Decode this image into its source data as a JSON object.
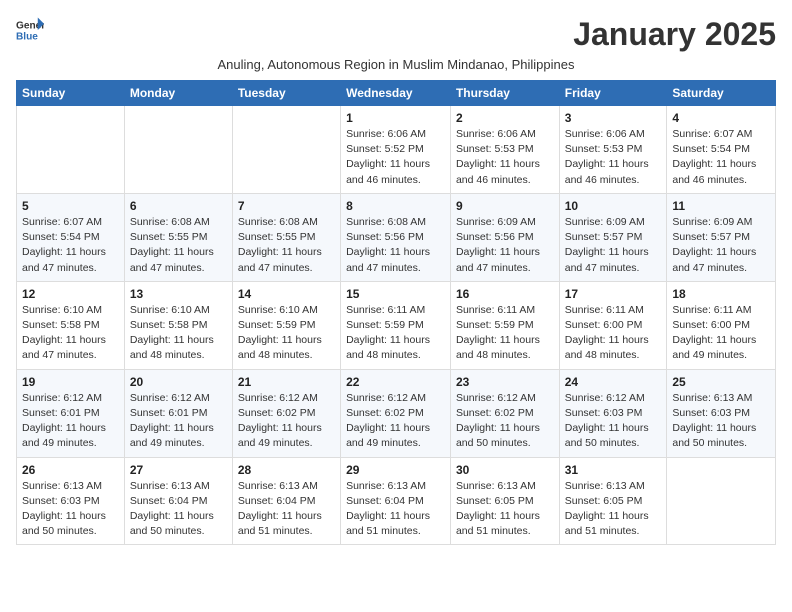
{
  "logo": {
    "general": "General",
    "blue": "Blue"
  },
  "title": "January 2025",
  "subtitle": "Anuling, Autonomous Region in Muslim Mindanao, Philippines",
  "days_of_week": [
    "Sunday",
    "Monday",
    "Tuesday",
    "Wednesday",
    "Thursday",
    "Friday",
    "Saturday"
  ],
  "weeks": [
    [
      {
        "day": "",
        "sunrise": "",
        "sunset": "",
        "daylight": ""
      },
      {
        "day": "",
        "sunrise": "",
        "sunset": "",
        "daylight": ""
      },
      {
        "day": "",
        "sunrise": "",
        "sunset": "",
        "daylight": ""
      },
      {
        "day": "1",
        "sunrise": "Sunrise: 6:06 AM",
        "sunset": "Sunset: 5:52 PM",
        "daylight": "Daylight: 11 hours and 46 minutes."
      },
      {
        "day": "2",
        "sunrise": "Sunrise: 6:06 AM",
        "sunset": "Sunset: 5:53 PM",
        "daylight": "Daylight: 11 hours and 46 minutes."
      },
      {
        "day": "3",
        "sunrise": "Sunrise: 6:06 AM",
        "sunset": "Sunset: 5:53 PM",
        "daylight": "Daylight: 11 hours and 46 minutes."
      },
      {
        "day": "4",
        "sunrise": "Sunrise: 6:07 AM",
        "sunset": "Sunset: 5:54 PM",
        "daylight": "Daylight: 11 hours and 46 minutes."
      }
    ],
    [
      {
        "day": "5",
        "sunrise": "Sunrise: 6:07 AM",
        "sunset": "Sunset: 5:54 PM",
        "daylight": "Daylight: 11 hours and 47 minutes."
      },
      {
        "day": "6",
        "sunrise": "Sunrise: 6:08 AM",
        "sunset": "Sunset: 5:55 PM",
        "daylight": "Daylight: 11 hours and 47 minutes."
      },
      {
        "day": "7",
        "sunrise": "Sunrise: 6:08 AM",
        "sunset": "Sunset: 5:55 PM",
        "daylight": "Daylight: 11 hours and 47 minutes."
      },
      {
        "day": "8",
        "sunrise": "Sunrise: 6:08 AM",
        "sunset": "Sunset: 5:56 PM",
        "daylight": "Daylight: 11 hours and 47 minutes."
      },
      {
        "day": "9",
        "sunrise": "Sunrise: 6:09 AM",
        "sunset": "Sunset: 5:56 PM",
        "daylight": "Daylight: 11 hours and 47 minutes."
      },
      {
        "day": "10",
        "sunrise": "Sunrise: 6:09 AM",
        "sunset": "Sunset: 5:57 PM",
        "daylight": "Daylight: 11 hours and 47 minutes."
      },
      {
        "day": "11",
        "sunrise": "Sunrise: 6:09 AM",
        "sunset": "Sunset: 5:57 PM",
        "daylight": "Daylight: 11 hours and 47 minutes."
      }
    ],
    [
      {
        "day": "12",
        "sunrise": "Sunrise: 6:10 AM",
        "sunset": "Sunset: 5:58 PM",
        "daylight": "Daylight: 11 hours and 47 minutes."
      },
      {
        "day": "13",
        "sunrise": "Sunrise: 6:10 AM",
        "sunset": "Sunset: 5:58 PM",
        "daylight": "Daylight: 11 hours and 48 minutes."
      },
      {
        "day": "14",
        "sunrise": "Sunrise: 6:10 AM",
        "sunset": "Sunset: 5:59 PM",
        "daylight": "Daylight: 11 hours and 48 minutes."
      },
      {
        "day": "15",
        "sunrise": "Sunrise: 6:11 AM",
        "sunset": "Sunset: 5:59 PM",
        "daylight": "Daylight: 11 hours and 48 minutes."
      },
      {
        "day": "16",
        "sunrise": "Sunrise: 6:11 AM",
        "sunset": "Sunset: 5:59 PM",
        "daylight": "Daylight: 11 hours and 48 minutes."
      },
      {
        "day": "17",
        "sunrise": "Sunrise: 6:11 AM",
        "sunset": "Sunset: 6:00 PM",
        "daylight": "Daylight: 11 hours and 48 minutes."
      },
      {
        "day": "18",
        "sunrise": "Sunrise: 6:11 AM",
        "sunset": "Sunset: 6:00 PM",
        "daylight": "Daylight: 11 hours and 49 minutes."
      }
    ],
    [
      {
        "day": "19",
        "sunrise": "Sunrise: 6:12 AM",
        "sunset": "Sunset: 6:01 PM",
        "daylight": "Daylight: 11 hours and 49 minutes."
      },
      {
        "day": "20",
        "sunrise": "Sunrise: 6:12 AM",
        "sunset": "Sunset: 6:01 PM",
        "daylight": "Daylight: 11 hours and 49 minutes."
      },
      {
        "day": "21",
        "sunrise": "Sunrise: 6:12 AM",
        "sunset": "Sunset: 6:02 PM",
        "daylight": "Daylight: 11 hours and 49 minutes."
      },
      {
        "day": "22",
        "sunrise": "Sunrise: 6:12 AM",
        "sunset": "Sunset: 6:02 PM",
        "daylight": "Daylight: 11 hours and 49 minutes."
      },
      {
        "day": "23",
        "sunrise": "Sunrise: 6:12 AM",
        "sunset": "Sunset: 6:02 PM",
        "daylight": "Daylight: 11 hours and 50 minutes."
      },
      {
        "day": "24",
        "sunrise": "Sunrise: 6:12 AM",
        "sunset": "Sunset: 6:03 PM",
        "daylight": "Daylight: 11 hours and 50 minutes."
      },
      {
        "day": "25",
        "sunrise": "Sunrise: 6:13 AM",
        "sunset": "Sunset: 6:03 PM",
        "daylight": "Daylight: 11 hours and 50 minutes."
      }
    ],
    [
      {
        "day": "26",
        "sunrise": "Sunrise: 6:13 AM",
        "sunset": "Sunset: 6:03 PM",
        "daylight": "Daylight: 11 hours and 50 minutes."
      },
      {
        "day": "27",
        "sunrise": "Sunrise: 6:13 AM",
        "sunset": "Sunset: 6:04 PM",
        "daylight": "Daylight: 11 hours and 50 minutes."
      },
      {
        "day": "28",
        "sunrise": "Sunrise: 6:13 AM",
        "sunset": "Sunset: 6:04 PM",
        "daylight": "Daylight: 11 hours and 51 minutes."
      },
      {
        "day": "29",
        "sunrise": "Sunrise: 6:13 AM",
        "sunset": "Sunset: 6:04 PM",
        "daylight": "Daylight: 11 hours and 51 minutes."
      },
      {
        "day": "30",
        "sunrise": "Sunrise: 6:13 AM",
        "sunset": "Sunset: 6:05 PM",
        "daylight": "Daylight: 11 hours and 51 minutes."
      },
      {
        "day": "31",
        "sunrise": "Sunrise: 6:13 AM",
        "sunset": "Sunset: 6:05 PM",
        "daylight": "Daylight: 11 hours and 51 minutes."
      },
      {
        "day": "",
        "sunrise": "",
        "sunset": "",
        "daylight": ""
      }
    ]
  ]
}
